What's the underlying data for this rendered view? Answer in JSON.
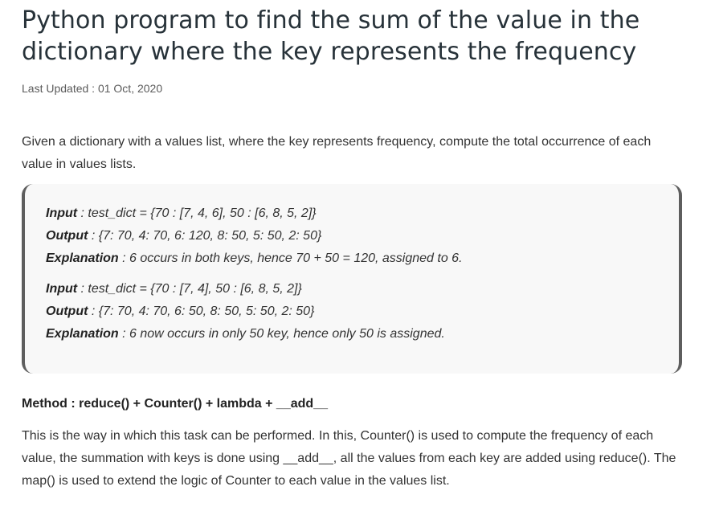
{
  "article": {
    "title": "Python program to find the sum of the value in the dictionary where the key represents the frequency",
    "last_updated": "Last Updated : 01 Oct, 2020",
    "intro": "Given a dictionary with a values list, where the key represents frequency, compute the total occurrence of each value in values lists."
  },
  "examples": [
    {
      "input_label": "Input",
      "input_text": " : test_dict = {70 : [7, 4, 6], 50 : [6, 8, 5, 2]}",
      "output_label": "Output",
      "output_text": " : {7: 70, 4: 70, 6: 120, 8: 50, 5: 50, 2: 50}",
      "explanation_label": "Explanation",
      "explanation_text": " : 6 occurs in both keys, hence 70 + 50 = 120, assigned to 6."
    },
    {
      "input_label": "Input",
      "input_text": " : test_dict = {70 : [7, 4], 50 : [6, 8, 5, 2]}",
      "output_label": "Output",
      "output_text": " : {7: 70, 4: 70, 6: 50, 8: 50, 5: 50, 2: 50}",
      "explanation_label": "Explanation",
      "explanation_text": " : 6 now occurs in only 50 key, hence only 50 is assigned."
    }
  ],
  "method": {
    "heading": "Method : reduce() + Counter() + lambda + __add__",
    "body": "This is the way in which this task can be performed. In this, Counter() is used to compute the frequency of each value, the summation with keys is done using __add__, all the values from each key are added using reduce(). The map() is used to extend the logic of Counter to each value in the values list."
  }
}
